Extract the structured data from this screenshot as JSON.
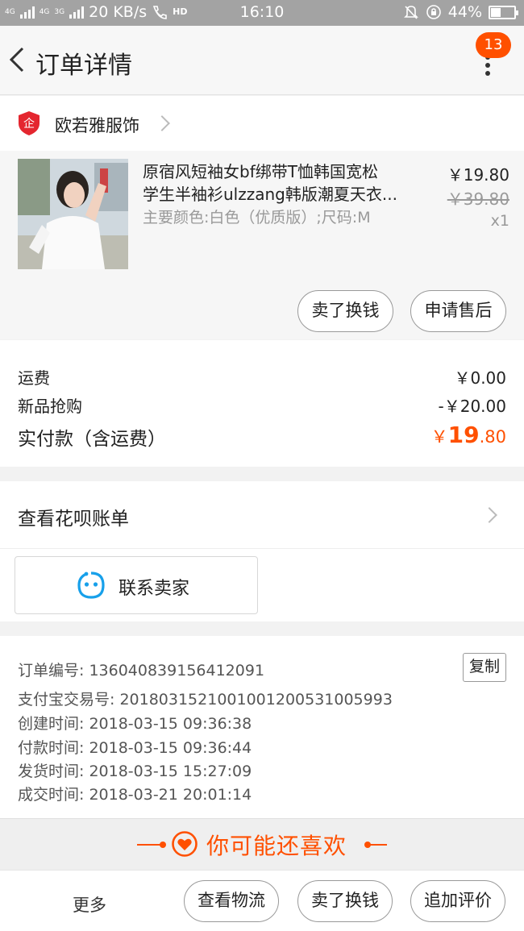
{
  "status_bar": {
    "net1": "4G",
    "net2": "4G",
    "net3": "3G",
    "speed": "20 KB/s",
    "hd": "HD",
    "time": "16:10",
    "battery": "44%",
    "battery_level": 0.44
  },
  "header": {
    "title": "订单详情",
    "badge_count": "13"
  },
  "shop": {
    "logo_glyph": "企",
    "name": "欧若雅服饰"
  },
  "product": {
    "title_line1": "原宿风短袖女bf绑带T恤韩国宽松",
    "title_line2": "学生半袖衫ulzzang韩版潮夏天衣...",
    "sku": "主要颜色:白色（优质版）;尺码:M",
    "price": "￥19.80",
    "original_price": "￥39.80",
    "quantity": "x1",
    "actions": {
      "resell": "卖了换钱",
      "after_sale": "申请售后"
    }
  },
  "fees": {
    "shipping_label": "运费",
    "shipping_value": "￥0.00",
    "promo_label": "新品抢购",
    "promo_value": "-￥20.00",
    "total_label": "实付款（含运费）",
    "total_currency": "￥",
    "total_int": "19",
    "total_dec": ".80"
  },
  "huabei": {
    "label": "查看花呗账单"
  },
  "contact": {
    "label": "联系卖家"
  },
  "order_info": {
    "order_no": "订单编号: 136040839156412091",
    "alipay_no": "支付宝交易号: 2018031521001001200531005993",
    "created": "创建时间: 2018-03-15 09:36:38",
    "paid": "付款时间: 2018-03-15 09:36:44",
    "shipped": "发货时间: 2018-03-15 15:27:09",
    "completed": "成交时间: 2018-03-21 20:01:14",
    "copy_label": "复制"
  },
  "guess": {
    "label": "你可能还喜欢"
  },
  "bottom_bar": {
    "more": "更多",
    "logistics": "查看物流",
    "resell": "卖了换钱",
    "review": "追加评价"
  },
  "colors": {
    "accent": "#ff5000",
    "status_bar": "#a3a3a3"
  }
}
